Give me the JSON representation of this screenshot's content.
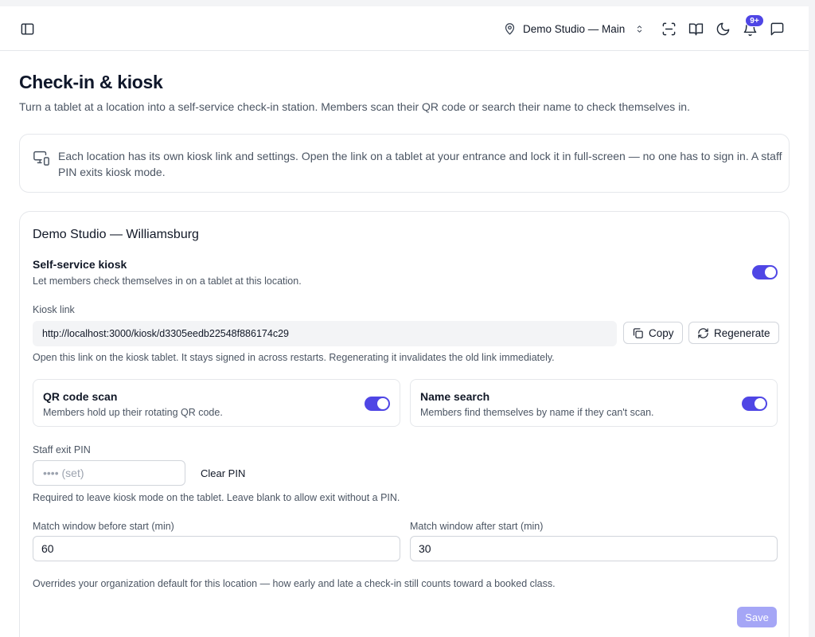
{
  "header": {
    "location": "Demo Studio — Main",
    "notification_badge": "9+",
    "icons": [
      "sidebar-toggle-icon",
      "map-pin-icon",
      "chevrons-up-down-icon",
      "scan-icon",
      "book-open-icon",
      "moon-icon",
      "bell-icon",
      "message-square-icon"
    ]
  },
  "page": {
    "title": "Check-in & kiosk",
    "subtitle": "Turn a tablet at a location into a self-service check-in station. Members scan their QR code or search their name to check themselves in."
  },
  "info": {
    "text": "Each location has its own kiosk link and settings. Open the link on a tablet at your entrance and lock it in full-screen — no one has to sign in. A staff PIN exits kiosk mode."
  },
  "location_card": {
    "title": "Demo Studio — Williamsburg",
    "kiosk": {
      "label": "Self-service kiosk",
      "description": "Let members check themselves in on a tablet at this location.",
      "enabled": true
    },
    "kiosk_link": {
      "label": "Kiosk link",
      "value": "http://localhost:3000/kiosk/d3305eedb22548f886174c29",
      "copy_label": "Copy",
      "regenerate_label": "Regenerate",
      "help": "Open this link on the kiosk tablet. It stays signed in across restarts. Regenerating it invalidates the old link immediately."
    },
    "qr_scan": {
      "label": "QR code scan",
      "description": "Members hold up their rotating QR code.",
      "enabled": true
    },
    "name_search": {
      "label": "Name search",
      "description": "Members find themselves by name if they can't scan.",
      "enabled": true
    },
    "pin": {
      "label": "Staff exit PIN",
      "placeholder": "•••• (set)",
      "clear_label": "Clear PIN",
      "help": "Required to leave kiosk mode on the tablet. Leave blank to allow exit without a PIN."
    },
    "match_before": {
      "label": "Match window before start (min)",
      "value": "60"
    },
    "match_after": {
      "label": "Match window after start (min)",
      "value": "30"
    },
    "match_help": "Overrides your organization default for this location — how early and late a check-in still counts toward a booked class.",
    "save_label": "Save"
  },
  "colors": {
    "accent": "#4f46e5",
    "save_disabled": "#a5a6f6",
    "border": "#e5e7eb",
    "muted_text": "#4b5563"
  }
}
